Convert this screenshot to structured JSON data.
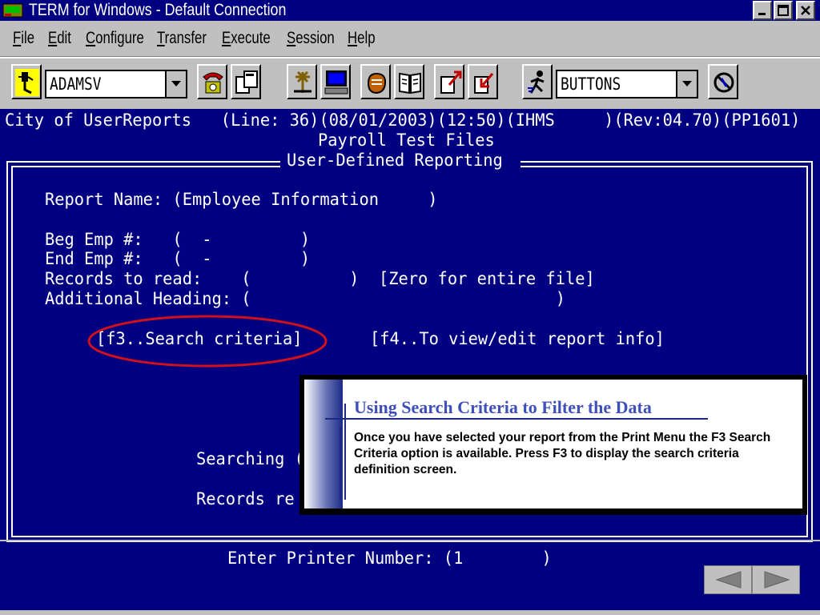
{
  "window": {
    "title": "TERM for Windows - Default Connection"
  },
  "menu": {
    "items": [
      "File",
      "Edit",
      "Configure",
      "Transfer",
      "Execute",
      "Session",
      "Help"
    ]
  },
  "toolbar": {
    "connection_value": "ADAMSV",
    "buttons_value": "BUTTONS"
  },
  "terminal": {
    "status_line": "City of UserReports   (Line: 36)(08/01/2003)(12:50)(IHMS     )(Rev:04.70)(PP1601)",
    "subtitle": "Payroll Test Files",
    "frame_title": "User-Defined Reporting",
    "report_name_line": "Report Name: (Employee Information     )",
    "beg_emp_line": "Beg Emp #:   (  -         )",
    "end_emp_line": "End Emp #:   (  -         )",
    "records_line": "Records to read:    (          )  [Zero for entire file]",
    "heading_line": "Additional Heading: (                               )",
    "f3_label": "[f3..Search criteria]",
    "f4_label": "[f4..To view/edit report info]",
    "searching_partial": "Searching (",
    "records_partial": "Records re",
    "printer_line": "Enter Printer Number: (1        )"
  },
  "callout": {
    "heading": "Using Search Criteria to Filter the Data",
    "body": "Once you have selected your report from the Print Menu the F3 Search Criteria option is available.  Press F3 to display the search criteria definition screen."
  },
  "colors": {
    "terminal_bg": "#000080",
    "highlight": "#d0101a",
    "callout_heading": "#3f4fb8"
  }
}
